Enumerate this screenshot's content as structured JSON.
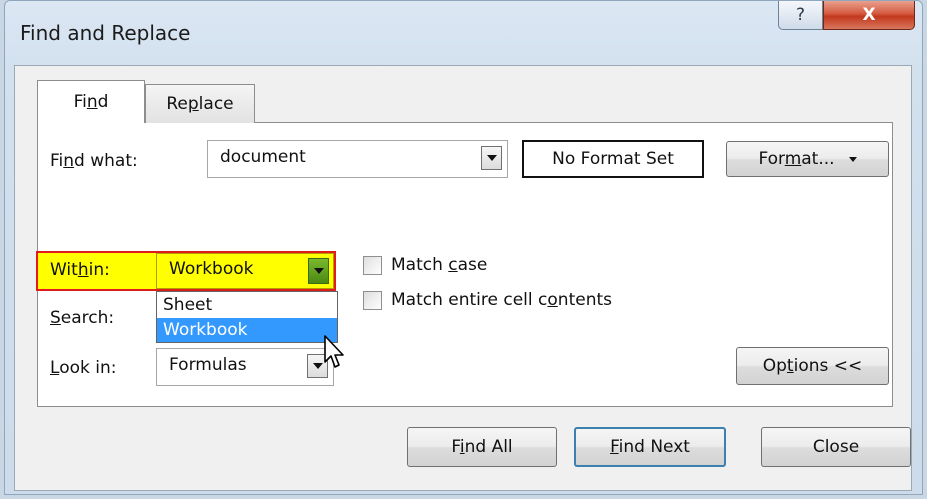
{
  "window": {
    "title": "Find and Replace",
    "help_glyph": "?",
    "close_glyph": "X"
  },
  "tabs": {
    "find": {
      "pre": "Fi",
      "key": "n",
      "post": "d"
    },
    "replace": {
      "pre": "Re",
      "key": "p",
      "post": "lace"
    }
  },
  "find_what": {
    "label_pre": "Fi",
    "label_key": "n",
    "label_post": "d what:",
    "value": "document"
  },
  "format_status": "No Format Set",
  "format_button": {
    "pre": "For",
    "key": "m",
    "post": "at..."
  },
  "within": {
    "label_pre": "Wit",
    "label_key": "h",
    "label_post": "in:",
    "value": "Workbook",
    "options": [
      "Sheet",
      "Workbook"
    ],
    "selected_option": "Workbook"
  },
  "search": {
    "label_pre": "",
    "label_key": "S",
    "label_post": "earch:"
  },
  "look_in": {
    "label_pre": "",
    "label_key": "L",
    "label_post": "ook in:",
    "value": "Formulas"
  },
  "match_case": {
    "pre": "Match ",
    "key": "c",
    "post": "ase",
    "checked": false
  },
  "match_entire": {
    "pre": "Match entire cell c",
    "key": "o",
    "post": "ntents",
    "checked": false
  },
  "options_button": {
    "pre": "Op",
    "key": "t",
    "post": "ions <<"
  },
  "buttons": {
    "find_all": {
      "pre": "F",
      "key": "i",
      "post": "nd All"
    },
    "find_next": {
      "pre": "",
      "key": "F",
      "post": "ind Next"
    },
    "close": "Close"
  },
  "colors": {
    "highlight_fill": "#ffff00",
    "highlight_border": "#e01b1b",
    "selection_blue": "#3399ff",
    "close_red": "#c2381d"
  }
}
